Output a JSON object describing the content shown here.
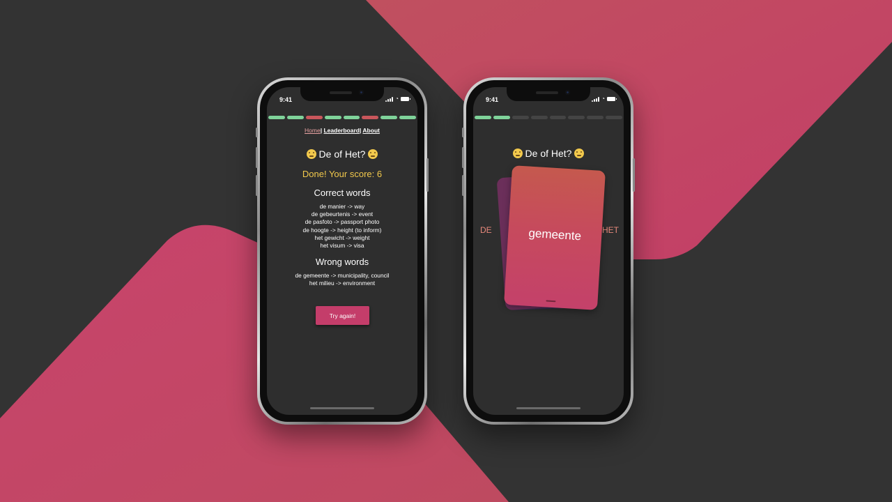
{
  "colors": {
    "background": "#333333",
    "accent_pink": "#c0476a",
    "progress_correct": "#7fd39a",
    "progress_wrong": "#c9565b",
    "progress_pending": "#444444",
    "score_yellow": "#f2c94c",
    "button": "#c43d6a"
  },
  "phone_left": {
    "status_time": "9:41",
    "progress": [
      "correct",
      "correct",
      "wrong",
      "correct",
      "correct",
      "wrong",
      "correct",
      "correct"
    ],
    "nav": {
      "home": "Home",
      "sep1": "|",
      "leaderboard": "Leaderboard",
      "sep2": "|",
      "about": "About"
    },
    "title": "De of Het?",
    "score": "Done! Your score: 6",
    "correct_heading": "Correct words",
    "correct_words": [
      "de manier -> way",
      "de gebeurtenis -> event",
      "de pasfoto -> passport photo",
      "de hoogte -> height (to inform)",
      "het gewicht -> weight",
      "het visum -> visa"
    ],
    "wrong_heading": "Wrong words",
    "wrong_words": [
      "de gemeente -> municipality, council",
      "het milieu -> environment"
    ],
    "try_again": "Try again!"
  },
  "phone_right": {
    "status_time": "9:41",
    "progress": [
      "correct",
      "correct",
      "pending",
      "pending",
      "pending",
      "pending",
      "pending",
      "pending"
    ],
    "title": "De of Het?",
    "left_label": "DE",
    "right_label": "HET",
    "card_word": "gemeente"
  }
}
